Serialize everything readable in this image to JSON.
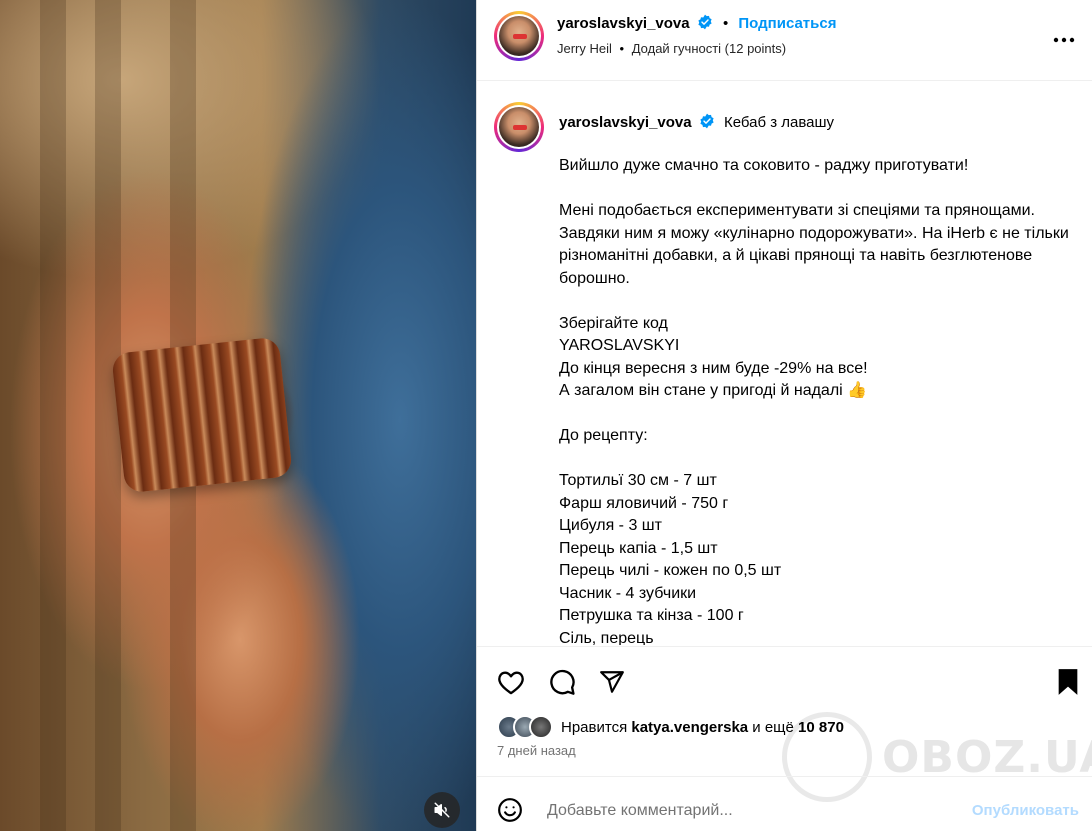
{
  "header": {
    "username": "yaroslavskyi_vova",
    "follow_label": "Подписаться",
    "music_artist": "Jerry Heil",
    "music_track": "Додай гучності (12 points)",
    "separator": "•"
  },
  "caption": {
    "username": "yaroslavskyi_vova",
    "title": "Кебаб з лавашу",
    "lines": [
      "Вийшло дуже смачно та соковито - раджу приготувати!",
      "",
      "Мені подобається експериментувати зі спеціями та прянощами. Завдяки ним я можу «кулінарно подорожувати». На iHerb є не тільки різноманітні добавки, а й цікаві прянощі та навіть безглютенове борошно.",
      "",
      "Зберігайте код",
      "YAROSLAVSKYI",
      "До кінця вересня з ним буде -29% на все!",
      "А загалом він стане у пригоді й надалі 👍",
      "",
      "До рецепту:",
      "",
      "Тортильї 30 см - 7 шт",
      "Фарш яловичий - 750 г",
      "Цибуля - 3 шт",
      "Перець капіа - 1,5 шт",
      "Перець чилі - кожен по 0,5 шт",
      "Часник - 4 зубчики",
      "Петрушка та кінза - 100 г",
      "Сіль, перець"
    ]
  },
  "likes": {
    "prefix": "Нравится",
    "user": "katya.vengerska",
    "suffix": "и ещё",
    "count": "10 870"
  },
  "time_ago": "7 дней назад",
  "comment": {
    "placeholder": "Добавьте комментарий...",
    "publish_label": "Опубликовать"
  },
  "watermark": "OBOZ.UA",
  "colors": {
    "accent": "#0095f6",
    "publish_disabled": "#b3dbff",
    "verified": "#0095f6"
  },
  "icons": {
    "like": "heart-icon",
    "comment": "comment-icon",
    "share": "paper-plane-icon",
    "save": "bookmark-icon",
    "more": "more-horizontal-icon",
    "emoji": "smiley-icon",
    "mute": "speaker-muted-icon"
  }
}
